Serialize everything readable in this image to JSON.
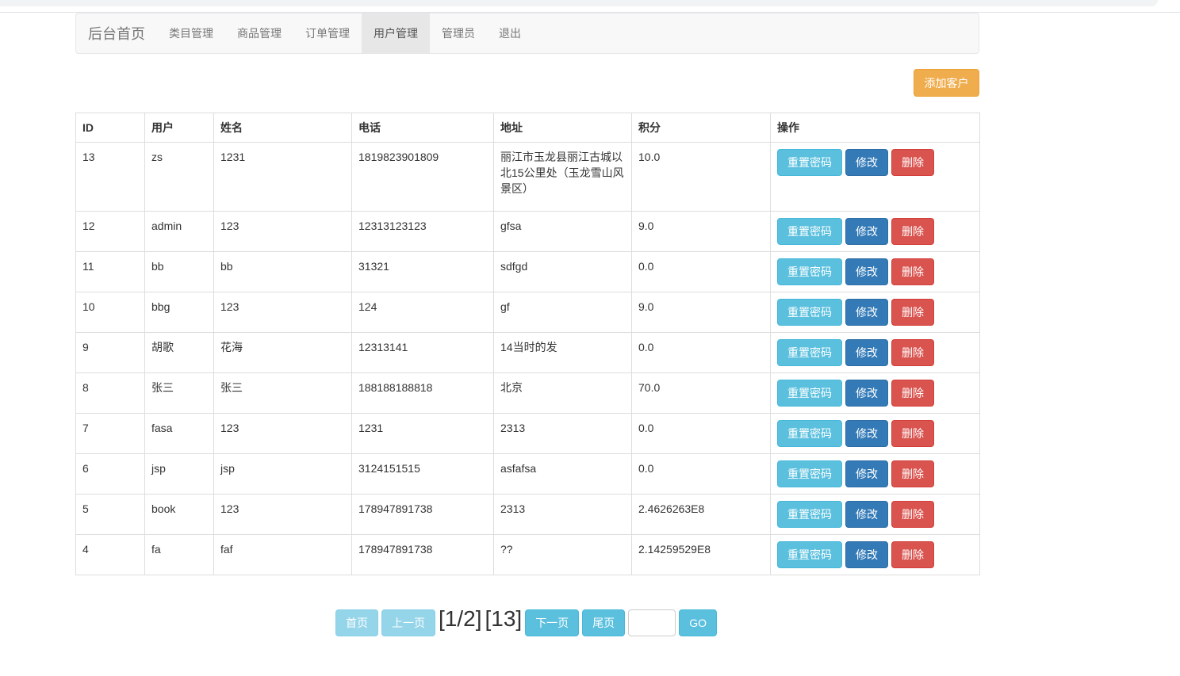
{
  "nav": {
    "brand": "后台首页",
    "items": [
      {
        "label": "类目管理",
        "active": false
      },
      {
        "label": "商品管理",
        "active": false
      },
      {
        "label": "订单管理",
        "active": false
      },
      {
        "label": "用户管理",
        "active": true
      },
      {
        "label": "管理员",
        "active": false
      },
      {
        "label": "退出",
        "active": false
      }
    ]
  },
  "add_button": "添加客户",
  "table": {
    "headers": [
      "ID",
      "用户",
      "姓名",
      "电话",
      "地址",
      "积分",
      "操作"
    ],
    "rows": [
      [
        "13",
        "zs",
        "1231",
        "1819823901809",
        "丽江市玉龙县丽江古城以北15公里处（玉龙雪山风景区）",
        "10.0"
      ],
      [
        "12",
        "admin",
        "123",
        "12313123123",
        "gfsa",
        "9.0"
      ],
      [
        "11",
        "bb",
        "bb",
        "31321",
        "sdfgd",
        "0.0"
      ],
      [
        "10",
        "bbg",
        "123",
        "124",
        "gf",
        "9.0"
      ],
      [
        "9",
        "胡歌",
        "花海",
        "12313141",
        "14当时的发",
        "0.0"
      ],
      [
        "8",
        "张三",
        "张三",
        "188188188818",
        "北京",
        "70.0"
      ],
      [
        "7",
        "fasa",
        "123",
        "1231",
        "2313",
        "0.0"
      ],
      [
        "6",
        "jsp",
        "jsp",
        "3124151515",
        "asfafsa",
        "0.0"
      ],
      [
        "5",
        "book",
        "123",
        "178947891738",
        "2313",
        "2.4626263E8"
      ],
      [
        "4",
        "fa",
        "faf",
        "178947891738",
        "??",
        "2.14259529E8"
      ]
    ],
    "actions": {
      "reset": "重置密码",
      "edit": "修改",
      "delete": "删除"
    }
  },
  "pager": {
    "first": "首页",
    "prev": "上一页",
    "page_info": "[1/2]",
    "total": "[13]",
    "next": "下一页",
    "last": "尾页",
    "go_value": "",
    "go": "GO"
  },
  "colors": {
    "warning": "#f0ad4e",
    "info": "#5bc0de",
    "primary": "#337ab7",
    "danger": "#d9534f"
  }
}
